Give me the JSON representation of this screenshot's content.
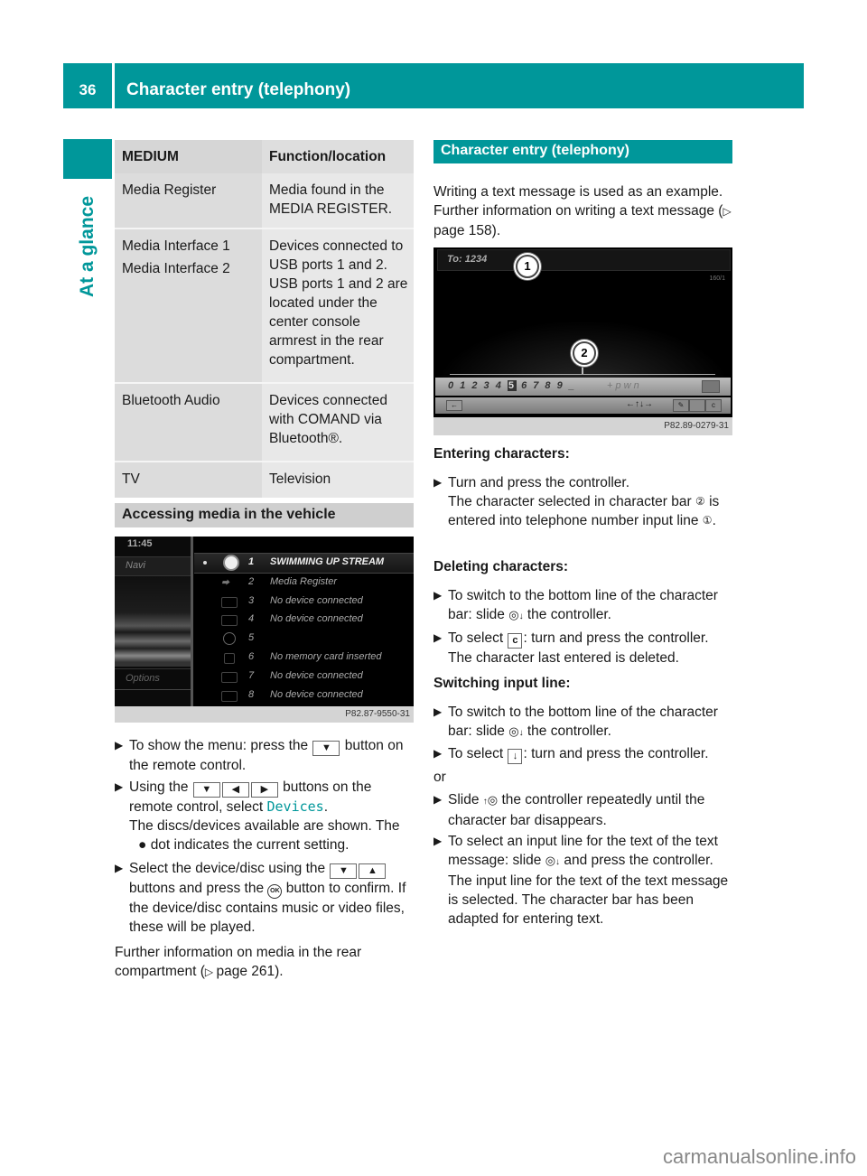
{
  "header": {
    "page_number": "36",
    "title": "Character entry (telephony)"
  },
  "sidebar": {
    "section_label": "At a glance"
  },
  "media_table": {
    "columns": [
      "MEDIUM",
      "Function/location"
    ],
    "rows": [
      {
        "medium": [
          "Media Register"
        ],
        "function": "Media found in the MEDIA REGISTER."
      },
      {
        "medium": [
          "Media Interface 1",
          "Media Interface 2"
        ],
        "function": "Devices connected to USB ports 1 and 2. USB ports 1 and 2 are located under the center console armrest in the rear compartment."
      },
      {
        "medium": [
          "Bluetooth Audio"
        ],
        "function": "Devices connected with COMAND via Bluetooth®."
      },
      {
        "medium": [
          "TV"
        ],
        "function": "Television"
      }
    ]
  },
  "accessing": {
    "heading": "Accessing media in the vehicle",
    "screen": {
      "clock": "11:45",
      "left_menu_top": "Navi",
      "left_menu_bottom": "Options",
      "items": [
        {
          "num": "1",
          "label": "SWIMMING UP STREAM",
          "selected": true
        },
        {
          "num": "2",
          "label": "Media Register"
        },
        {
          "num": "3",
          "label": "No device connected"
        },
        {
          "num": "4",
          "label": "No device connected"
        },
        {
          "num": "5",
          "label": ""
        },
        {
          "num": "6",
          "label": "No memory card inserted"
        },
        {
          "num": "7",
          "label": "No device connected"
        },
        {
          "num": "8",
          "label": "No device connected"
        }
      ],
      "caption": "P82.87-9550-31"
    },
    "steps": {
      "s1_a": "To show the menu: press the",
      "s1_b": "button on the remote control.",
      "s2_a": "Using the",
      "s2_b": "buttons on the remote control, select",
      "s2_devices": "Devices",
      "s2_c": "The discs/devices available are shown. The",
      "s2_d": "dot indicates the current setting.",
      "s3_a": "Select the device/disc using the",
      "s3_b": "buttons and press the",
      "s3_c": "button to confirm.",
      "s3_d": "If the device/disc contains music or video files, these will be played."
    },
    "keys": {
      "down": "▼",
      "left": "◀",
      "right": "▶",
      "up": "▲",
      "ok": "OK"
    },
    "further": "Further information on media in the rear compartment (",
    "further_ref": "page 261",
    "further_end": ")."
  },
  "char_entry": {
    "heading": "Character entry (telephony)",
    "intro": "Writing a text message is used as an example. Further information on writing a text message (",
    "intro_ref": "page 158",
    "intro_end": ").",
    "screen": {
      "to_line": "To: 1234",
      "counter": "160/1",
      "chars_before": "0 1 2 3 4",
      "char_selected": "5",
      "chars_after": "6 7 8 9 _",
      "mode": "+ p w n",
      "caption": "P82.89-0279-31",
      "callout_1": "1",
      "callout_2": "2"
    },
    "entering": {
      "heading": "Entering characters:",
      "step": "Turn and press the controller.",
      "result_a": "The character selected in character bar",
      "result_b": "is entered into telephone number input line",
      "c1": "①",
      "c2": "②"
    },
    "deleting": {
      "heading": "Deleting characters:",
      "step1_a": "To switch to the bottom line of the character bar: slide",
      "step1_b": "the controller.",
      "step2_a": "To select",
      "step2_key": "c",
      "step2_b": ": turn and press the controller.",
      "step2_result": "The character last entered is deleted."
    },
    "switching": {
      "heading": "Switching input line:",
      "step1_a": "To switch to the bottom line of the character bar: slide",
      "step1_b": "the controller.",
      "step2_a": "To select",
      "step2_key": "↓",
      "step2_b": ": turn and press the controller.",
      "or": "or",
      "step3_a": "Slide",
      "step3_b": "the controller repeatedly until the character bar disappears.",
      "step4_a": "To select an input line for the text of the text message: slide",
      "step4_b": "and press the controller.",
      "step4_result": "The input line for the text of the text message is selected. The character bar has been adapted for entering text."
    },
    "controller_glyph": "◎",
    "down_arrow": "↓",
    "up_arrow": "↑"
  },
  "watermark": "carmanualsonline.info",
  "colors": {
    "brand_teal": "#00979a",
    "section_grey": "#cfcfcf"
  }
}
